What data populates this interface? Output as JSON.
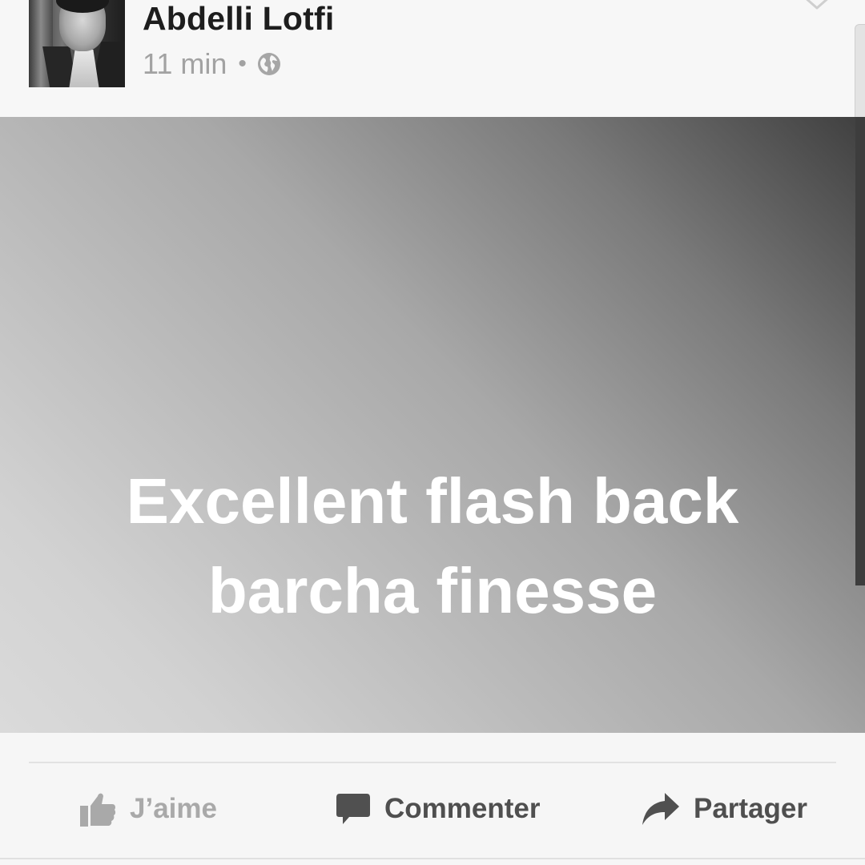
{
  "post": {
    "author": "Abdelli Lotfi",
    "time": "11 min",
    "separator": "•",
    "privacy_icon": "globe-icon",
    "menu_icon": "chevron-down-icon"
  },
  "status": {
    "line1": "Excellent flash back",
    "line2": "barcha finesse"
  },
  "actions": {
    "like": "J’aime",
    "comment": "Commenter",
    "share": "Partager"
  },
  "colors": {
    "author_text": "#1d1d1d",
    "meta_text": "#a2a2a2",
    "like_text": "#a9a9a9",
    "action_text": "#4f4f4f",
    "status_text": "#ffffff"
  }
}
